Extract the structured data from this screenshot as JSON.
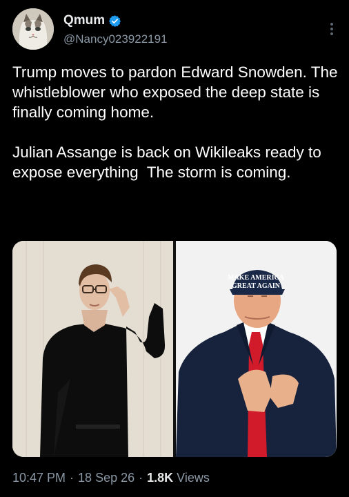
{
  "author": {
    "display_name": "Qmum",
    "handle": "@Nancy023922191",
    "verified": true
  },
  "tweet": {
    "text": "Trump moves to pardon Edward Snowden. The whistleblower who exposed the deep state is finally coming home.\n\nJulian Assange is back on Wikileaks ready to expose everything  The storm is coming."
  },
  "media": {
    "hat_line1": "MAKE AMERICA",
    "hat_line2": "GREAT AGAIN"
  },
  "meta": {
    "time": "10:47 PM",
    "separator": "·",
    "date": "18 Sep 26",
    "views_count": "1.8K",
    "views_label": "Views"
  },
  "colors": {
    "background": "#000000",
    "verified_badge": "#1d9bf0",
    "secondary_text": "#8b98a5"
  }
}
